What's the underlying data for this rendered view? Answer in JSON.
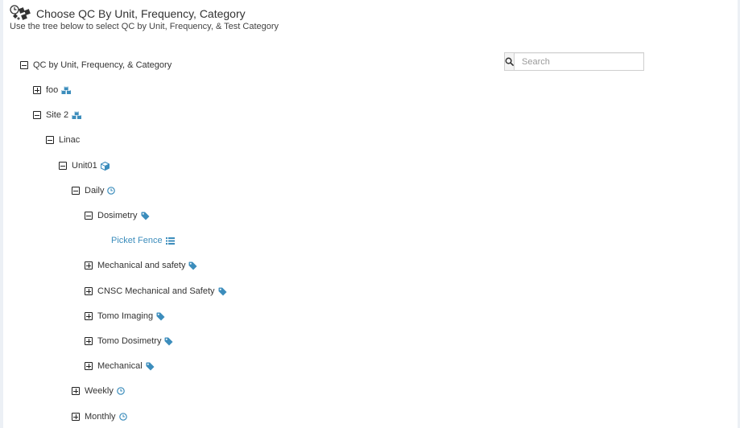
{
  "header": {
    "title": "Choose QC By Unit, Frequency, Category",
    "subtitle": "Use the tree below to select QC by Unit, Frequency, & Test Category"
  },
  "search": {
    "placeholder": "Search",
    "value": ""
  },
  "colors": {
    "accent": "#3c8dbc",
    "text": "#333333"
  },
  "tree": {
    "root": {
      "label": "QC by Unit, Frequency, & Category",
      "expanded": true
    },
    "foo": {
      "label": "foo",
      "icon": "cubes-icon",
      "expanded": false
    },
    "site": {
      "label": "Site 2",
      "icon": "cubes-icon",
      "expanded": true
    },
    "linac": {
      "label": "Linac",
      "expanded": true
    },
    "unit": {
      "label": "Unit01",
      "icon": "cube-icon",
      "expanded": true
    },
    "daily": {
      "label": "Daily",
      "icon": "clock-icon",
      "expanded": true
    },
    "dosimetry": {
      "label": "Dosimetry",
      "icon": "tag-icon",
      "expanded": true
    },
    "picket_fence": {
      "label": "Picket Fence",
      "icon": "list-icon"
    },
    "mechanical_safety": {
      "label": "Mechanical and safety",
      "icon": "tag-icon",
      "expanded": false
    },
    "cnsc": {
      "label": "CNSC Mechanical and Safety",
      "icon": "tag-icon",
      "expanded": false
    },
    "tomo_imaging": {
      "label": "Tomo Imaging",
      "icon": "tag-icon",
      "expanded": false
    },
    "tomo_dosimetry": {
      "label": "Tomo Dosimetry",
      "icon": "tag-icon",
      "expanded": false
    },
    "mechanical": {
      "label": "Mechanical",
      "icon": "tag-icon",
      "expanded": false
    },
    "weekly": {
      "label": "Weekly",
      "icon": "clock-icon",
      "expanded": false
    },
    "monthly": {
      "label": "Monthly",
      "icon": "clock-icon",
      "expanded": false
    }
  }
}
